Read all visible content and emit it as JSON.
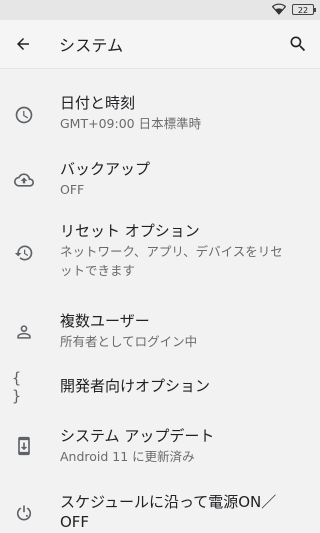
{
  "status_bar": {
    "battery_level": "22",
    "wifi_icon": "wifi-icon"
  },
  "toolbar": {
    "back_icon": "arrow-back-icon",
    "title": "システム",
    "search_icon": "search-icon"
  },
  "items": [
    {
      "icon": "clock-icon",
      "title": "日付と時刻",
      "summary": "GMT+09:00 日本標準時"
    },
    {
      "icon": "cloud-upload-icon",
      "title": "バックアップ",
      "summary": "OFF"
    },
    {
      "icon": "restore-icon",
      "title": "リセット オプション",
      "summary_line1": "ネットワーク、アプリ、デバイスをリセ",
      "summary_line2": "ットできます"
    },
    {
      "icon": "person-icon",
      "title": "複数ユーザー",
      "summary": "所有者としてログイン中"
    },
    {
      "icon": "code-braces-icon",
      "title": "開発者向けオプション",
      "icon_text": "{ }"
    },
    {
      "icon": "system-update-icon",
      "title": "システム アップデート",
      "summary": "Android 11 に更新済み"
    },
    {
      "icon": "power-schedule-icon",
      "title_line1": "スケジュールに沿って電源ON／",
      "title_line2": "OFF"
    }
  ]
}
